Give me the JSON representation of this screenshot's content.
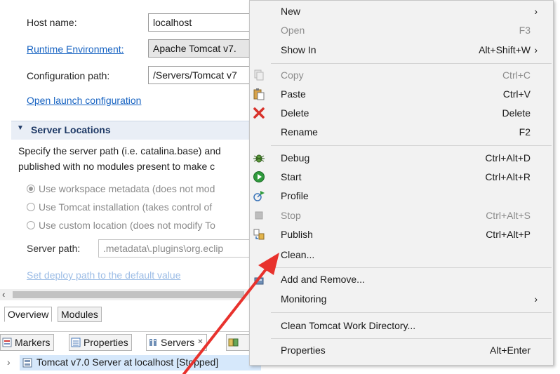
{
  "editor": {
    "host_label": "Host name:",
    "host_value": "localhost",
    "runtime_label": "Runtime Environment:",
    "runtime_value": "Apache Tomcat v7.",
    "config_label": "Configuration path:",
    "config_value": "/Servers/Tomcat v7",
    "open_launch": "Open launch configuration",
    "locations_header": "Server Locations",
    "desc_line1": "Specify the server path (i.e. catalina.base) and",
    "desc_line2": "published with no modules present to make c",
    "radio1": "Use workspace metadata (does not mod",
    "radio2": "Use Tomcat installation (takes control of",
    "radio3": "Use custom location (does not modify To",
    "server_path_label": "Server path:",
    "server_path_value": ".metadata\\.plugins\\org.eclip",
    "deploy_link": "Set deploy path to the default value",
    "tab_overview": "Overview",
    "tab_modules": "Modules"
  },
  "views": {
    "markers": "Markers",
    "properties": "Properties",
    "servers": "Servers",
    "servers_close": "✕",
    "server_row": "Tomcat v7.0 Server at localhost  [Stopped]"
  },
  "menu": {
    "items": [
      {
        "label": "New",
        "shortcut": "",
        "arrow": "›",
        "disabled": false,
        "icon": ""
      },
      {
        "label": "Open",
        "shortcut": "F3",
        "arrow": "",
        "disabled": true,
        "icon": ""
      },
      {
        "label": "Show In",
        "shortcut": "Alt+Shift+W",
        "arrow": "›",
        "disabled": false,
        "icon": ""
      },
      {
        "label": "Copy",
        "shortcut": "Ctrl+C",
        "arrow": "",
        "disabled": true,
        "icon": "copy-icon"
      },
      {
        "label": "Paste",
        "shortcut": "Ctrl+V",
        "arrow": "",
        "disabled": false,
        "icon": "paste-icon"
      },
      {
        "label": "Delete",
        "shortcut": "Delete",
        "arrow": "",
        "disabled": false,
        "icon": "delete-icon"
      },
      {
        "label": "Rename",
        "shortcut": "F2",
        "arrow": "",
        "disabled": false,
        "icon": ""
      },
      {
        "label": "Debug",
        "shortcut": "Ctrl+Alt+D",
        "arrow": "",
        "disabled": false,
        "icon": "debug-icon"
      },
      {
        "label": "Start",
        "shortcut": "Ctrl+Alt+R",
        "arrow": "",
        "disabled": false,
        "icon": "start-icon"
      },
      {
        "label": "Profile",
        "shortcut": "",
        "arrow": "",
        "disabled": false,
        "icon": "profile-icon"
      },
      {
        "label": "Stop",
        "shortcut": "Ctrl+Alt+S",
        "arrow": "",
        "disabled": true,
        "icon": "stop-icon"
      },
      {
        "label": "Publish",
        "shortcut": "Ctrl+Alt+P",
        "arrow": "",
        "disabled": false,
        "icon": "publish-icon"
      },
      {
        "label": "Clean...",
        "shortcut": "",
        "arrow": "",
        "disabled": false,
        "icon": "clean-icon"
      },
      {
        "label": "Add and Remove...",
        "shortcut": "",
        "arrow": "",
        "disabled": false,
        "icon": "add-remove-icon"
      },
      {
        "label": "Monitoring",
        "shortcut": "",
        "arrow": "›",
        "disabled": false,
        "icon": ""
      },
      {
        "label": "Clean Tomcat Work Directory...",
        "shortcut": "",
        "arrow": "",
        "disabled": false,
        "icon": ""
      },
      {
        "label": "Properties",
        "shortcut": "Alt+Enter",
        "arrow": "",
        "disabled": false,
        "icon": ""
      }
    ]
  },
  "colors": {
    "link": "#1763c2",
    "section_header": "#1f3a66",
    "menu_bg": "#f2f2f2",
    "arrow_annotation": "#e8322d",
    "selection": "#d6e8fb"
  }
}
